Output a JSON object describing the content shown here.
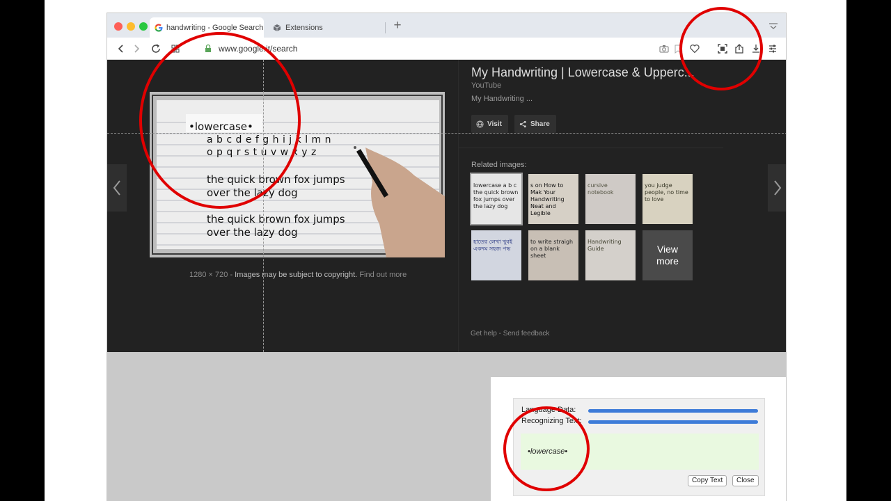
{
  "browser": {
    "tabs": [
      {
        "label": "handwriting - Google Search",
        "icon": "google-g-icon",
        "active": true
      },
      {
        "label": "Extensions",
        "icon": "puzzle-icon",
        "active": false
      }
    ],
    "url": "www.google.it/search"
  },
  "viewer": {
    "image_text": {
      "heading": "•lowercase•",
      "alphabet1": "a b c d e f g h i j k l m n",
      "alphabet2": "o p q r s t u v w x y z",
      "line1": "the quick brown fox jumps",
      "line2": "over the lazy dog",
      "line3": "the quick brown fox jumps",
      "line4": "over the lazy dog"
    },
    "dims": "1280 × 720",
    "copyright": "Images may be subject to copyright.",
    "find_out_more": "Find out more",
    "title": "My Handwriting | Lowercase & Upperc...",
    "source": "YouTube",
    "description": "My Handwriting ...",
    "visit_label": "Visit",
    "share_label": "Share",
    "related_label": "Related images:",
    "related": [
      {
        "caption": "lowercase a b c the quick brown fox jumps over the lazy dog"
      },
      {
        "caption": "s on How to Mak Your Handwriting Neat and Legible"
      },
      {
        "caption": "cursive notebook"
      },
      {
        "caption": "you judge people, no time to love"
      },
      {
        "caption": "হাতের লেখা খুবই একদম সহজ পদ্ধ"
      },
      {
        "caption": "to write straigh on a blank sheet"
      },
      {
        "caption": "Handwriting Guide"
      },
      {
        "caption": "View more"
      }
    ],
    "view_more": "View more",
    "get_help": "Get help",
    "send_feedback": "Send feedback"
  },
  "ocr": {
    "language_data_label": "Language Data:",
    "recognizing_label": "Recognizing Text:",
    "language_progress": 1.0,
    "recognizing_progress": 1.0,
    "result": "•lowercase•",
    "copy_label": "Copy Text",
    "close_label": "Close"
  },
  "colors": {
    "annotation": "#e00000",
    "progress": "#3d7bd8"
  }
}
